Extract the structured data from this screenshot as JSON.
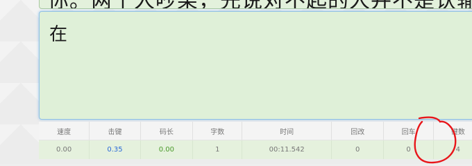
{
  "reference_text": "你。两个人吵架，先说对不起的人并不是认输了，",
  "typing": {
    "current_text": "在"
  },
  "stats": {
    "headers": [
      "速度",
      "击键",
      "码长",
      "字数",
      "时间",
      "回改",
      "回车",
      "键数"
    ],
    "values": [
      "0.00",
      "0.35",
      "0.00",
      "1",
      "00:11.542",
      "0",
      "0",
      "4"
    ]
  },
  "annotation": {
    "color": "#e8161a"
  }
}
